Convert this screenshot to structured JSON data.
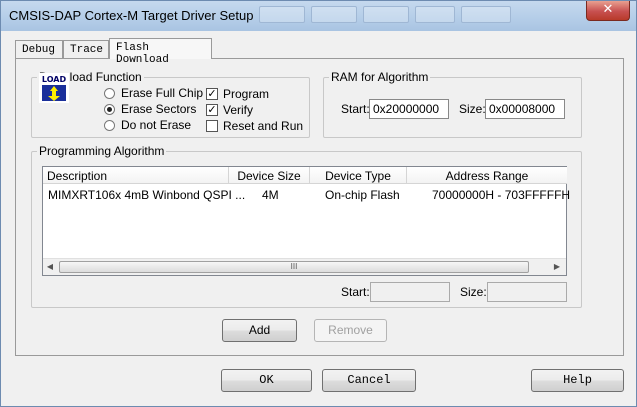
{
  "window": {
    "title": "CMSIS-DAP Cortex-M Target Driver Setup",
    "close_label": "✕"
  },
  "tabs": [
    {
      "label": "Debug"
    },
    {
      "label": "Trace"
    },
    {
      "label": "Flash Download"
    }
  ],
  "download_function": {
    "legend": "Download Function",
    "icon_text": "LOAD",
    "options": [
      {
        "label": "Erase Full Chip",
        "checked": false
      },
      {
        "label": "Erase Sectors",
        "checked": true
      },
      {
        "label": "Do not Erase",
        "checked": false
      }
    ],
    "checks": [
      {
        "label": "Program",
        "checked": true
      },
      {
        "label": "Verify",
        "checked": true
      },
      {
        "label": "Reset and Run",
        "checked": false
      }
    ],
    "checkmark": "✓"
  },
  "ram": {
    "legend": "RAM for Algorithm",
    "start_label": "Start:",
    "start_value": "0x20000000",
    "size_label": "Size:",
    "size_value": "0x00008000"
  },
  "programming": {
    "legend": "Programming Algorithm",
    "columns": [
      "Description",
      "Device Size",
      "Device Type",
      "Address Range"
    ],
    "rows": [
      {
        "description": "MIMXRT106x 4mB Winbond QSPI ...",
        "size": "4M",
        "type": "On-chip Flash",
        "range": "70000000H - 703FFFFFH"
      }
    ],
    "start_label": "Start:",
    "start_value": "",
    "size_label": "Size:",
    "size_value": "",
    "scroll_grip": "III"
  },
  "buttons": {
    "add": "Add",
    "remove": "Remove",
    "ok": "OK",
    "cancel": "Cancel",
    "help": "Help"
  }
}
